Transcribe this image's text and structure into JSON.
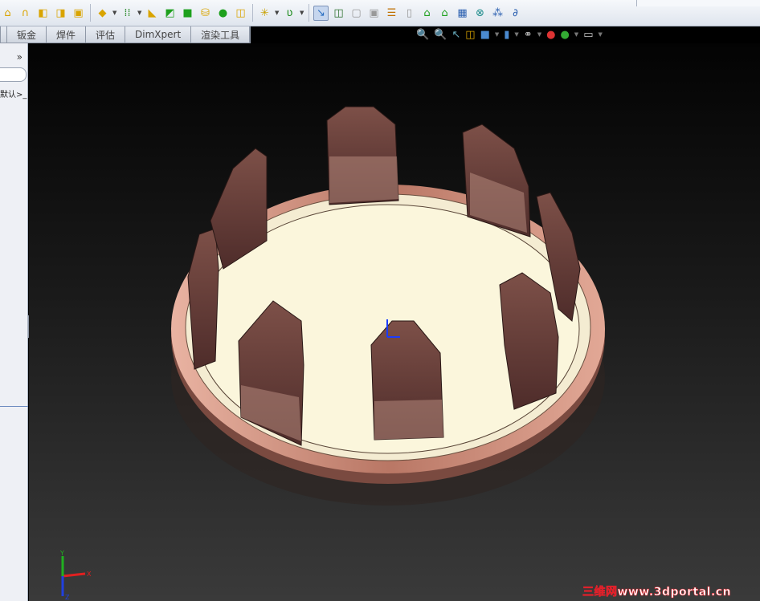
{
  "toolbar": {
    "icons": [
      "extruded-boss-icon",
      "revolved-boss-icon",
      "swept-boss-icon",
      "lofted-boss-icon",
      "boundary-boss-icon",
      "fillet-icon",
      "linear-pattern-icon",
      "rib-icon",
      "wrap-icon",
      "draft-icon",
      "shell-icon",
      "dome-icon",
      "mirror-icon",
      "reference-geometry-icon",
      "curves-icon",
      "instant3d-icon",
      "split-line-icon",
      "move-face-icon",
      "delete-face-icon",
      "freeform-icon",
      "intersect-icon",
      "flex-icon",
      "indent-icon",
      "deform-icon",
      "design-table-icon",
      "scale-icon",
      "equations-icon"
    ],
    "active_icon": "instant3d-icon"
  },
  "tabs": [
    "",
    "钣金",
    "焊件",
    "评估",
    "DimXpert",
    "渲染工具"
  ],
  "sidebar": {
    "expand": "»",
    "crumb": "默认>_"
  },
  "headsup_icons": [
    "zoom-to-fit-icon",
    "zoom-to-area-icon",
    "previous-view-icon",
    "section-view-icon",
    "view-orientation-icon",
    "display-style-icon",
    "hide-show-items-icon",
    "edit-appearance-icon",
    "apply-scene-icon",
    "view-settings-icon"
  ],
  "colors": {
    "copper": "#c98a78",
    "base": "#fbf6dc",
    "tab": "#6e4440",
    "background": "#000000"
  },
  "triad": {
    "x": "X",
    "y": "Y",
    "z": "Z"
  },
  "watermark": "三维网www.3dportal.cn"
}
